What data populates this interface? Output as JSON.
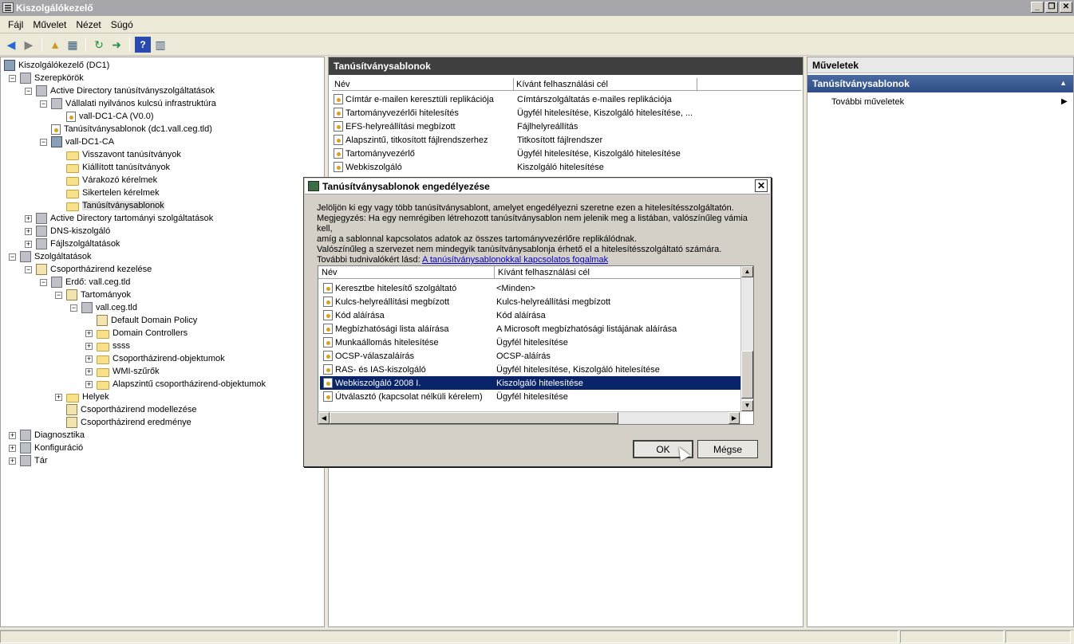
{
  "window": {
    "title": "Kiszolgálókezelő"
  },
  "menu": [
    "Fájl",
    "Művelet",
    "Nézet",
    "Súgó"
  ],
  "tree": [
    {
      "label": "Kiszolgálókezelő (DC1)",
      "level": 0,
      "exp": "",
      "icon": "server"
    },
    {
      "label": "Szerepkörök",
      "level": 1,
      "exp": "−",
      "icon": "gray"
    },
    {
      "label": "Active Directory tanúsítványszolgáltatások",
      "level": 2,
      "exp": "−",
      "icon": "gray"
    },
    {
      "label": "Vállalati nyilvános kulcsú infrastruktúra",
      "level": 3,
      "exp": "−",
      "icon": "gray"
    },
    {
      "label": "vall-DC1-CA (V0.0)",
      "level": 4,
      "exp": "",
      "icon": "cert"
    },
    {
      "label": "Tanúsítványsablonok (dc1.vall.ceg.tld)",
      "level": 3,
      "exp": "",
      "icon": "cert"
    },
    {
      "label": "vall-DC1-CA",
      "level": 3,
      "exp": "−",
      "icon": "server"
    },
    {
      "label": "Visszavont tanúsítványok",
      "level": 4,
      "exp": "",
      "icon": "folder"
    },
    {
      "label": "Kiállított tanúsítványok",
      "level": 4,
      "exp": "",
      "icon": "folder"
    },
    {
      "label": "Várakozó kérelmek",
      "level": 4,
      "exp": "",
      "icon": "folder"
    },
    {
      "label": "Sikertelen kérelmek",
      "level": 4,
      "exp": "",
      "icon": "folder"
    },
    {
      "label": "Tanúsítványsablonok",
      "level": 4,
      "exp": "",
      "icon": "folder",
      "selected": true
    },
    {
      "label": "Active Directory tartományi szolgáltatások",
      "level": 2,
      "exp": "+",
      "icon": "gray"
    },
    {
      "label": "DNS-kiszolgáló",
      "level": 2,
      "exp": "+",
      "icon": "gray"
    },
    {
      "label": "Fájlszolgáltatások",
      "level": 2,
      "exp": "+",
      "icon": "gray"
    },
    {
      "label": "Szolgáltatások",
      "level": 1,
      "exp": "−",
      "icon": "gray"
    },
    {
      "label": "Csoportházirend kezelése",
      "level": 2,
      "exp": "−",
      "icon": "gpo"
    },
    {
      "label": "Erdő: vall.ceg.tld",
      "level": 3,
      "exp": "−",
      "icon": "gray"
    },
    {
      "label": "Tartományok",
      "level": 4,
      "exp": "−",
      "icon": "gpo"
    },
    {
      "label": "vall.ceg.tld",
      "level": 5,
      "exp": "−",
      "icon": "gray"
    },
    {
      "label": "Default Domain Policy",
      "level": 6,
      "exp": "",
      "icon": "gpo"
    },
    {
      "label": "Domain Controllers",
      "level": 6,
      "exp": "+",
      "icon": "folder"
    },
    {
      "label": "ssss",
      "level": 6,
      "exp": "+",
      "icon": "folder"
    },
    {
      "label": "Csoportházirend-objektumok",
      "level": 6,
      "exp": "+",
      "icon": "folder"
    },
    {
      "label": "WMI-szűrők",
      "level": 6,
      "exp": "+",
      "icon": "folder"
    },
    {
      "label": "Alapszintű csoportházirend-objektumok",
      "level": 6,
      "exp": "+",
      "icon": "folder"
    },
    {
      "label": "Helyek",
      "level": 4,
      "exp": "+",
      "icon": "folder"
    },
    {
      "label": "Csoportházirend modellezése",
      "level": 4,
      "exp": "",
      "icon": "gpo"
    },
    {
      "label": "Csoportházirend eredménye",
      "level": 4,
      "exp": "",
      "icon": "gpo"
    },
    {
      "label": "Diagnosztika",
      "level": 1,
      "exp": "+",
      "icon": "gray"
    },
    {
      "label": "Konfiguráció",
      "level": 1,
      "exp": "+",
      "icon": "gray"
    },
    {
      "label": "Tár",
      "level": 1,
      "exp": "+",
      "icon": "gray"
    }
  ],
  "center": {
    "title": "Tanúsítványsablonok",
    "columns": [
      "Név",
      "Kívánt felhasználási cél"
    ],
    "rows": [
      [
        "Címtár e-mailen keresztüli replikációja",
        "Címtárszolgáltatás e-mailes replikációja"
      ],
      [
        "Tartományvezérlői hitelesítés",
        "Ügyfél hitelesítése, Kiszolgáló hitelesítése, ..."
      ],
      [
        "EFS-helyreállítási megbízott",
        "Fájlhelyreállítás"
      ],
      [
        "Alapszintű, titkosított fájlrendszerhez",
        "Titkosított fájlrendszer"
      ],
      [
        "Tartományvezérlő",
        "Ügyfél hitelesítése, Kiszolgáló hitelesítése"
      ],
      [
        "Webkiszolgáló",
        "Kiszolgáló hitelesítése"
      ]
    ]
  },
  "actions": {
    "header": "Műveletek",
    "section": "Tanúsítványsablonok",
    "item": "További műveletek"
  },
  "dialog": {
    "title": "Tanúsítványsablonok engedélyezése",
    "line1": "Jelöljön ki egy vagy több tanúsítványsablont, amelyet engedélyezni szeretne ezen a hitelesítésszolgáltatón.",
    "line2": "Megjegyzés: Ha egy nemrégiben létrehozott tanúsítványsablon nem jelenik meg a listában, valószínűleg vámia kell,",
    "line3": "amíg a sablonnal kapcsolatos adatok az összes tartományvezérlőre replikálódnak.",
    "line4": "Valószínűleg a szervezet nem mindegyik tanúsítványsablonja érhető el a hitelesítésszolgáltató számára.",
    "line5": "További tudnivalókért lásd: ",
    "link": "A tanúsítványsablonokkal kapcsolatos fogalmak",
    "columns": [
      "Név",
      "Kívánt felhasználási cél"
    ],
    "rows": [
      [
        "Keresztbe hitelesítő szolgáltató",
        "<Minden>"
      ],
      [
        "Kulcs-helyreállítási megbízott",
        "Kulcs-helyreállítási megbízott"
      ],
      [
        "Kód aláírása",
        "Kód aláírása"
      ],
      [
        "Megbízhatósági lista aláírása",
        "A Microsoft megbízhatósági listájának aláírása"
      ],
      [
        "Munkaállomás hitelesítése",
        "Ügyfél hitelesítése"
      ],
      [
        "OCSP-válaszaláírás",
        "OCSP-aláírás"
      ],
      [
        "RAS- és IAS-kiszolgáló",
        "Ügyfél hitelesítése, Kiszolgáló hitelesítése"
      ],
      [
        "Webkiszolgáló 2008 I.",
        "Kiszolgáló hitelesítése"
      ],
      [
        "Útválasztó (kapcsolat nélküli kérelem)",
        "Ügyfél hitelesítése"
      ]
    ],
    "selected_row": 7,
    "ok": "OK",
    "cancel": "Mégse"
  }
}
